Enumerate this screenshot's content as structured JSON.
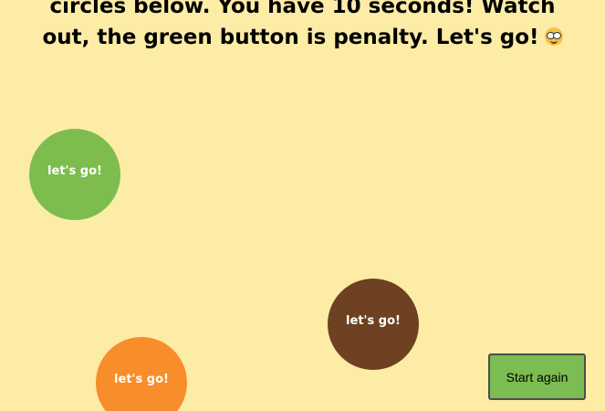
{
  "instructions": {
    "line_1": "circles below. You have 10 seconds! Watch",
    "line_2": "out, the green button is penalty. Let's go!",
    "emoji_icon": "nerd-face-emoji-icon"
  },
  "circles": [
    {
      "label": "let's go!",
      "color": "#7cbd4e"
    },
    {
      "label": "let's go!",
      "color": "#6d4121"
    },
    {
      "label": "let's go!",
      "color": "#f88d2b"
    }
  ],
  "controls": {
    "start_again_label": "Start again",
    "button_color": "#7bbd52"
  },
  "colors": {
    "background": "#fdeca6",
    "text": "#000000"
  }
}
